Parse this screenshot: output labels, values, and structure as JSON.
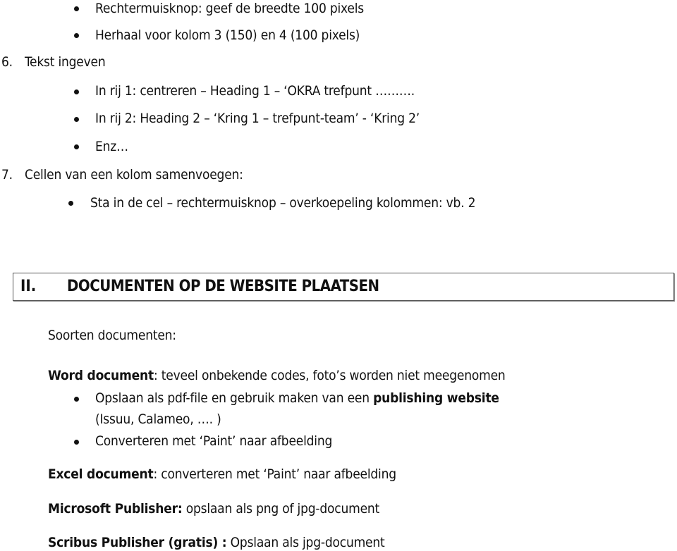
{
  "top_bullets": [
    "Rechtermuisknop: geef de breedte 100 pixels",
    "Herhaal voor kolom 3 (150) en 4 (100 pixels)"
  ],
  "step6": {
    "number": "6.",
    "title": "Tekst ingeven",
    "bullets": [
      "In rij 1: centreren – Heading 1 – ‘OKRA trefpunt ……….",
      "In rij 2: Heading 2 – ‘Kring 1 – trefpunt-team’  - ‘Kring 2’",
      "Enz…"
    ]
  },
  "step7": {
    "number": "7.",
    "title": "Cellen van een kolom samenvoegen:",
    "bullets": [
      "Sta in de cel – rechtermuisknop – overkoepeling kolommen: vb. 2"
    ]
  },
  "section2": {
    "number": "II.",
    "title": "DOCUMENTEN OP DE WEBSITE PLAATSEN"
  },
  "intro": "Soorten documenten:",
  "word": {
    "label": "Word document",
    "text": ": teveel onbekende codes, foto’s worden niet meegenomen",
    "bullet1_text": "Opslaan als pdf-file en gebruik maken van een ",
    "bullet1_bold": "publishing website",
    "bullet1_cont": "(Issuu, Calameo, …. )",
    "bullet2": "Converteren met ‘Paint’ naar afbeelding"
  },
  "excel": {
    "label": "Excel document",
    "text": ":  converteren met ‘Paint’ naar afbeelding"
  },
  "publisher": {
    "label": "Microsoft Publisher:",
    "text": " opslaan als png of jpg-document"
  },
  "scribus": {
    "label": "Scribus Publisher (gratis) :",
    "text": " Opslaan als jpg-document"
  }
}
